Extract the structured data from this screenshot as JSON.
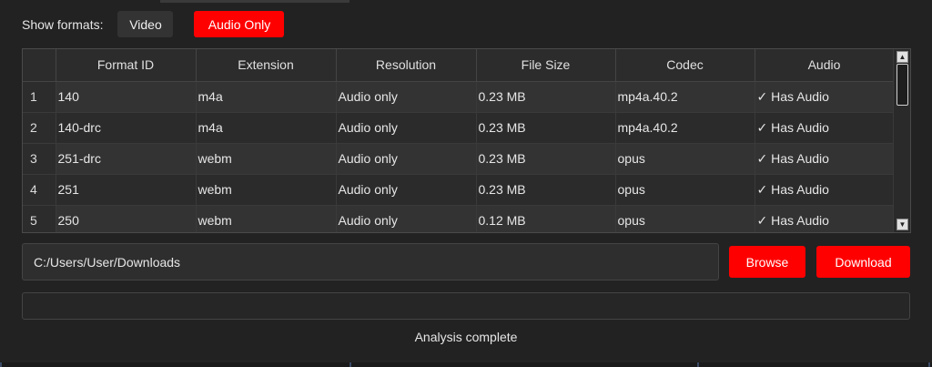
{
  "filter": {
    "label": "Show formats:",
    "video_label": "Video",
    "audio_label": "Audio Only"
  },
  "table": {
    "columns": [
      "Format ID",
      "Extension",
      "Resolution",
      "File Size",
      "Codec",
      "Audio"
    ],
    "rows": [
      {
        "num": "1",
        "cells": [
          "140",
          "m4a",
          "Audio only",
          "0.23 MB",
          "mp4a.40.2",
          "✓ Has Audio"
        ]
      },
      {
        "num": "2",
        "cells": [
          "140-drc",
          "m4a",
          "Audio only",
          "0.23 MB",
          "mp4a.40.2",
          "✓ Has Audio"
        ]
      },
      {
        "num": "3",
        "cells": [
          "251-drc",
          "webm",
          "Audio only",
          "0.23 MB",
          "opus",
          "✓ Has Audio"
        ]
      },
      {
        "num": "4",
        "cells": [
          "251",
          "webm",
          "Audio only",
          "0.23 MB",
          "opus",
          "✓ Has Audio"
        ]
      },
      {
        "num": "5",
        "cells": [
          "250",
          "webm",
          "Audio only",
          "0.12 MB",
          "opus",
          "✓ Has Audio"
        ]
      }
    ]
  },
  "output": {
    "path": "C:/Users/User/Downloads",
    "browse_label": "Browse",
    "download_label": "Download"
  },
  "status": {
    "text": "Analysis complete"
  },
  "colors": {
    "accent": "#ff0000",
    "background": "#222222"
  }
}
